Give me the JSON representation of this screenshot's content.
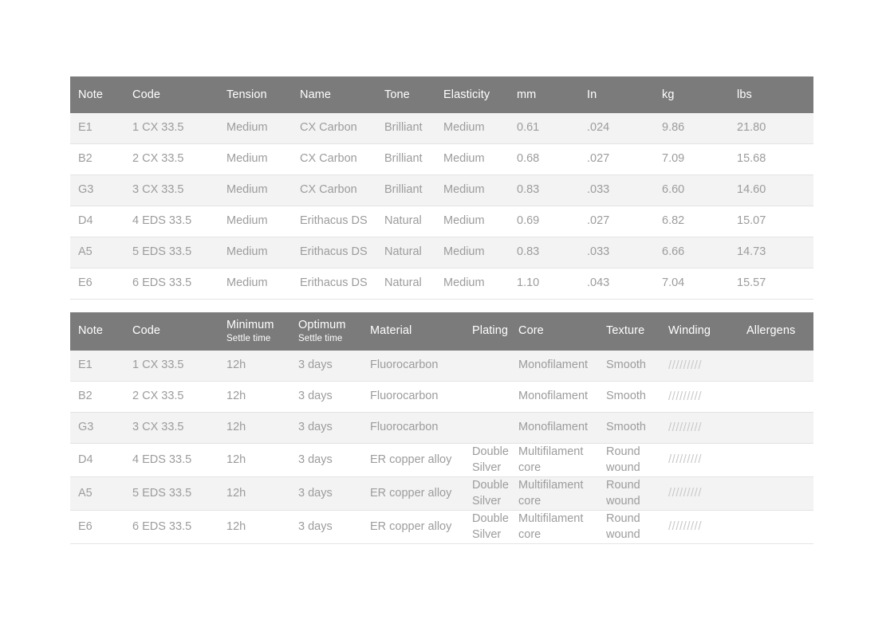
{
  "tables": [
    {
      "id": "string-specification-table",
      "columns": [
        {
          "label": "Note"
        },
        {
          "label": "Code"
        },
        {
          "label": "Tension"
        },
        {
          "label": "Name"
        },
        {
          "label": "Tone"
        },
        {
          "label": "Elasticity"
        },
        {
          "label": "mm"
        },
        {
          "label": "In"
        },
        {
          "label": "kg"
        },
        {
          "label": "lbs"
        }
      ],
      "rows": [
        [
          "E1",
          "1 CX 33.5",
          "Medium",
          "CX Carbon",
          "Brilliant",
          "Medium",
          "0.61",
          ".024",
          "9.86",
          "21.80"
        ],
        [
          "B2",
          "2 CX 33.5",
          "Medium",
          "CX Carbon",
          "Brilliant",
          "Medium",
          "0.68",
          ".027",
          "7.09",
          "15.68"
        ],
        [
          "G3",
          "3 CX 33.5",
          "Medium",
          "CX Carbon",
          "Brilliant",
          "Medium",
          "0.83",
          ".033",
          "6.60",
          "14.60"
        ],
        [
          "D4",
          "4 EDS 33.5",
          "Medium",
          "Erithacus DS",
          "Natural",
          "Medium",
          "0.69",
          ".027",
          "6.82",
          "15.07"
        ],
        [
          "A5",
          "5 EDS 33.5",
          "Medium",
          "Erithacus DS",
          "Natural",
          "Medium",
          "0.83",
          ".033",
          "6.66",
          "14.73"
        ],
        [
          "E6",
          "6 EDS 33.5",
          "Medium",
          "Erithacus DS",
          "Natural",
          "Medium",
          "1.10",
          ".043",
          "7.04",
          "15.57"
        ]
      ]
    },
    {
      "id": "construction-specification-table",
      "columns": [
        {
          "label": "Note",
          "sub": ""
        },
        {
          "label": "Code",
          "sub": ""
        },
        {
          "label": "Minimum",
          "sub": "Settle time"
        },
        {
          "label": "Optimum",
          "sub": "Settle time"
        },
        {
          "label": "Material",
          "sub": ""
        },
        {
          "label": "Plating",
          "sub": ""
        },
        {
          "label": "Core",
          "sub": ""
        },
        {
          "label": "Texture",
          "sub": ""
        },
        {
          "label": "Winding",
          "sub": ""
        },
        {
          "label": "Allergens",
          "sub": ""
        }
      ],
      "rows": [
        [
          "E1",
          "1 CX 33.5",
          "12h",
          "3 days",
          "Fluorocarbon",
          "",
          "Monofilament",
          "Smooth",
          "/////////",
          ""
        ],
        [
          "B2",
          "2 CX 33.5",
          "12h",
          "3 days",
          "Fluorocarbon",
          "",
          "Monofilament",
          "Smooth",
          "/////////",
          ""
        ],
        [
          "G3",
          "3 CX 33.5",
          "12h",
          "3 days",
          "Fluorocarbon",
          "",
          "Monofilament",
          "Smooth",
          "/////////",
          ""
        ],
        [
          "D4",
          "4 EDS 33.5",
          "12h",
          "3 days",
          "ER copper alloy",
          "Double\nSilver",
          "Multifilament\ncore",
          "Round\nwound",
          "/////////",
          ""
        ],
        [
          "A5",
          "5 EDS 33.5",
          "12h",
          "3 days",
          "ER copper alloy",
          "Double\nSilver",
          "Multifilament\ncore",
          "Round\nwound",
          "/////////",
          ""
        ],
        [
          "E6",
          "6 EDS 33.5",
          "12h",
          "3 days",
          "ER copper alloy",
          "Double\nSilver",
          "Multifilament\ncore",
          "Round\nwound",
          "/////////",
          ""
        ]
      ]
    }
  ],
  "colors": {
    "header_background": "#7b7b7b",
    "header_text": "#ffffff",
    "row_odd": "#f3f3f3",
    "row_even": "#ffffff",
    "cell_text": "#9c9c9c",
    "row_divider": "#e3e3e3",
    "winding_mark": "#c9c9c9",
    "page_background": "#ffffff"
  }
}
